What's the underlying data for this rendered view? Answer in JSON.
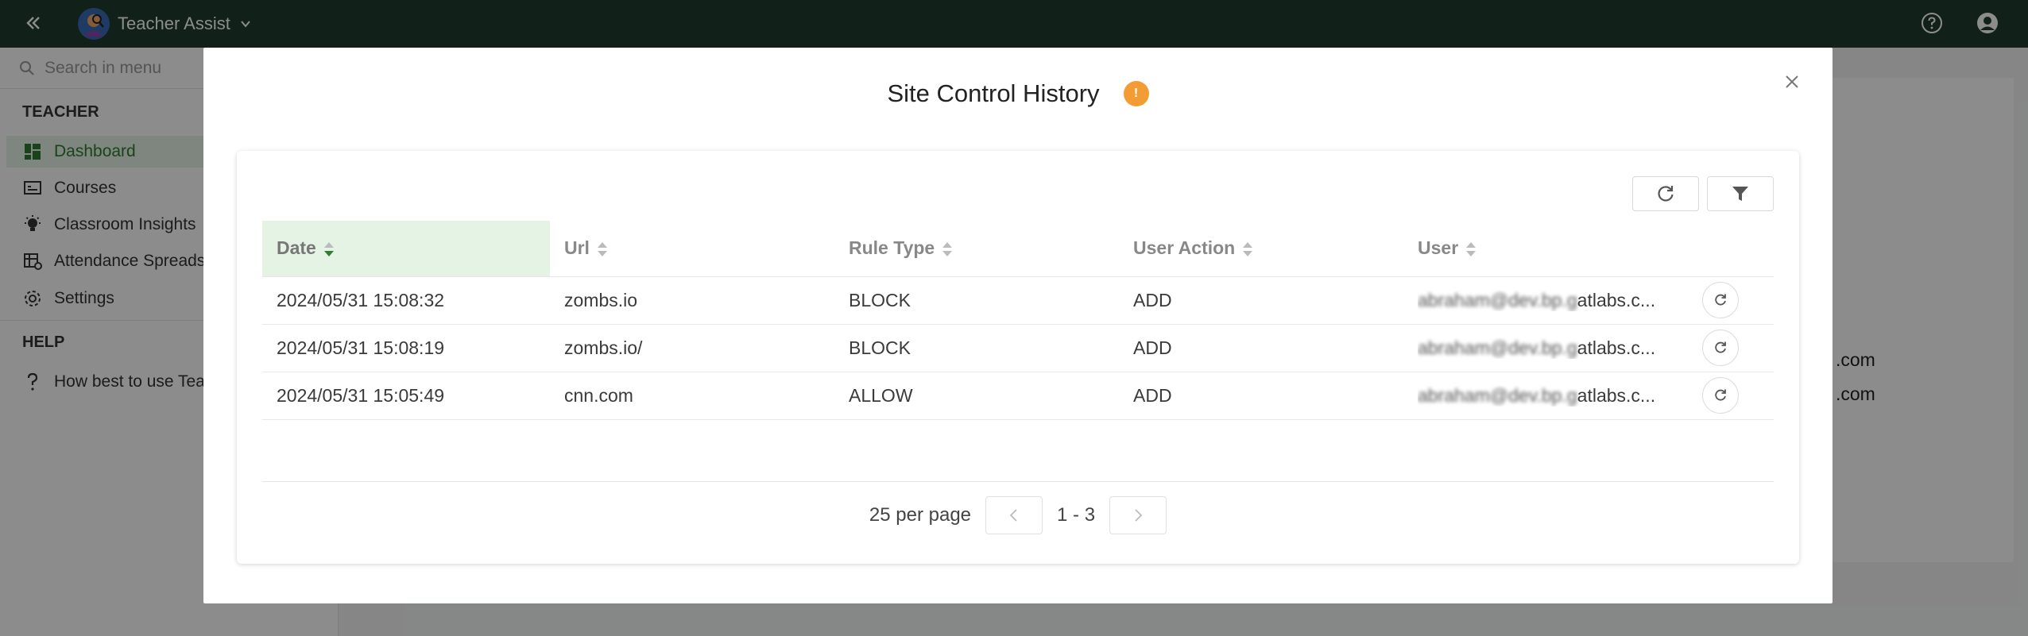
{
  "topbar": {
    "app_title": "Teacher Assist",
    "icons": [
      "collapse-icon",
      "chevron-down-icon",
      "help-icon",
      "user-account-icon"
    ]
  },
  "sidebar": {
    "search_placeholder": "Search in menu",
    "section_teacher": "TEACHER",
    "items": [
      {
        "label": "Dashboard",
        "icon": "dashboard-icon",
        "active": true
      },
      {
        "label": "Courses",
        "icon": "courses-icon"
      },
      {
        "label": "Classroom Insights",
        "icon": "lightbulb-icon"
      },
      {
        "label": "Attendance Spreads",
        "icon": "spreadsheet-icon"
      },
      {
        "label": "Settings",
        "icon": "gear-icon"
      }
    ],
    "section_help": "HELP",
    "help_items": [
      {
        "label": "How best to use Tea",
        "icon": "question-icon"
      }
    ]
  },
  "background": {
    "text_1": ".com",
    "text_2": ".com"
  },
  "modal": {
    "title": "Site Control History",
    "badge": "!",
    "table": {
      "columns": [
        "Date",
        "Url",
        "Rule Type",
        "User Action",
        "User"
      ],
      "sorted_column": "Date",
      "rows": [
        {
          "date": "2024/05/31 15:08:32",
          "url": "zombs.io",
          "rule_type": "BLOCK",
          "user_action": "ADD",
          "user_hidden": "abraham@dev.bp.g",
          "user_visible": "atlabs.c..."
        },
        {
          "date": "2024/05/31 15:08:19",
          "url": "zombs.io/",
          "rule_type": "BLOCK",
          "user_action": "ADD",
          "user_hidden": "abraham@dev.bp.g",
          "user_visible": "atlabs.c..."
        },
        {
          "date": "2024/05/31 15:05:49",
          "url": "cnn.com",
          "rule_type": "ALLOW",
          "user_action": "ADD",
          "user_hidden": "abraham@dev.bp.g",
          "user_visible": "atlabs.c..."
        }
      ]
    },
    "pagination": {
      "per_page": "25 per page",
      "range": "1 - 3"
    }
  },
  "colors": {
    "topbar": "#1f3d2e",
    "active_green": "#2e7d32",
    "badge_orange": "#f39c34",
    "sorted_header_bg": "#e5f3e5"
  }
}
